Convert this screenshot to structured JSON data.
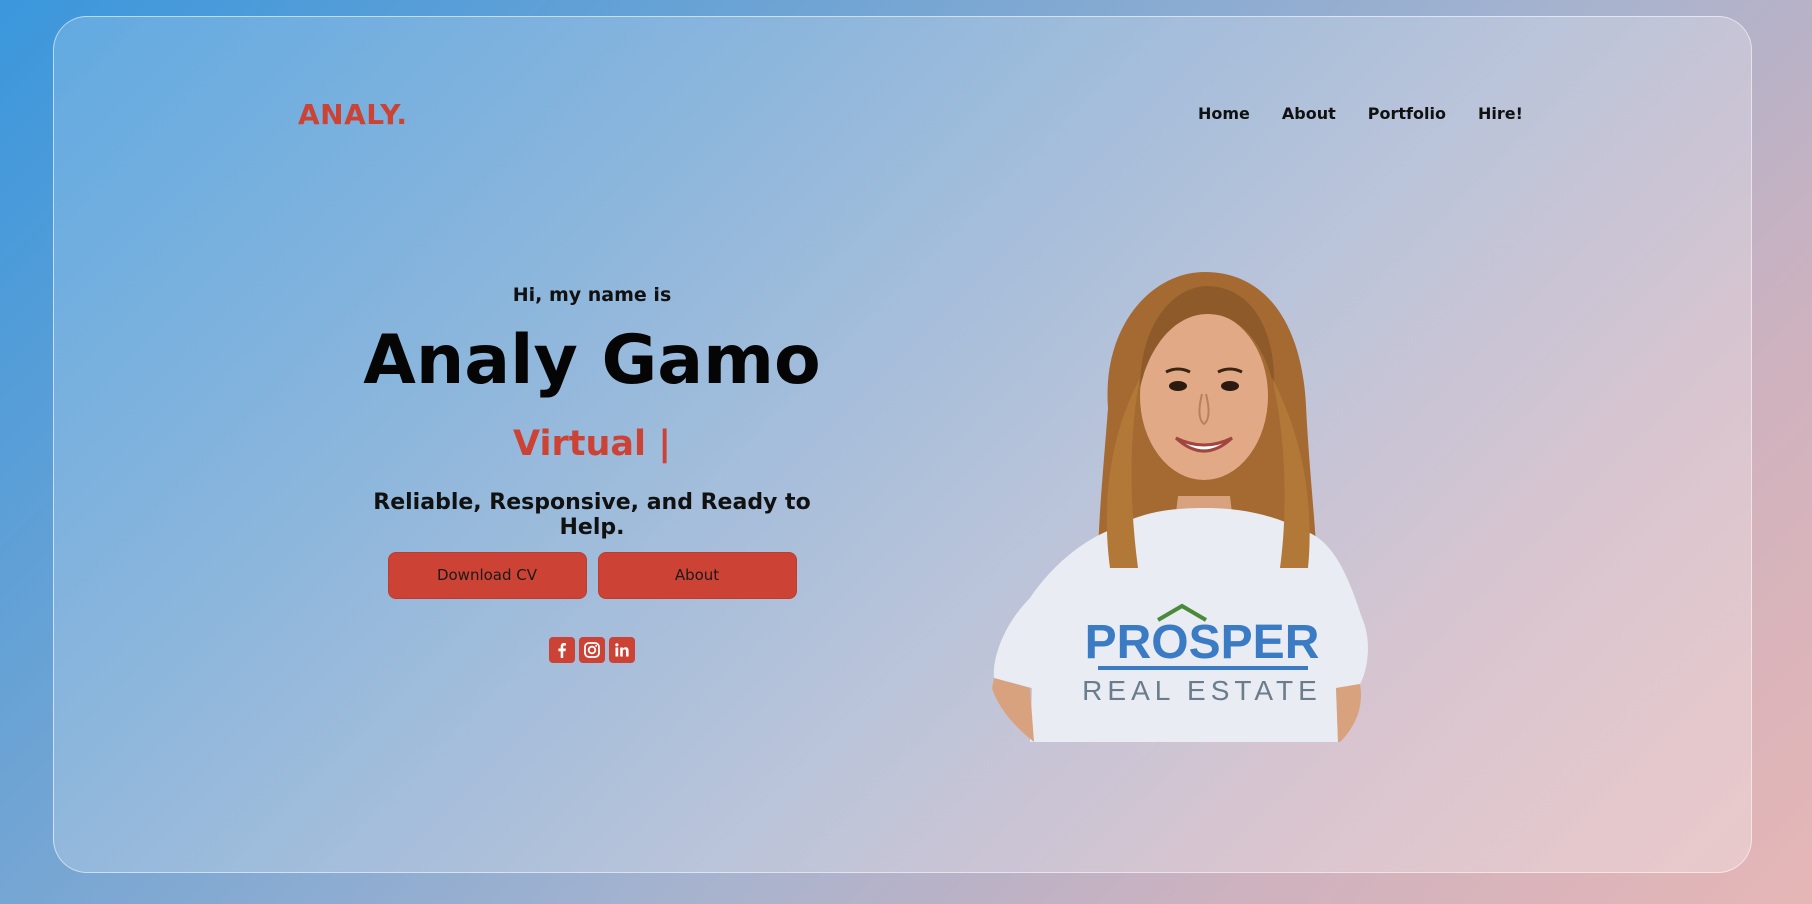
{
  "brand": {
    "logo_text": "ANALY.",
    "accent_color": "#cc4335"
  },
  "nav": {
    "items": [
      {
        "label": "Home"
      },
      {
        "label": "About"
      },
      {
        "label": "Portfolio"
      },
      {
        "label": "Hire!"
      }
    ]
  },
  "hero": {
    "greeting": "Hi, my name is",
    "name": "Analy Gamo",
    "role_typed": "Virtual |",
    "tagline": "Reliable, Responsive, and Ready to Help.",
    "buttons": {
      "download_cv": "Download CV",
      "about": "About"
    },
    "socials": [
      {
        "icon": "facebook-icon"
      },
      {
        "icon": "instagram-icon"
      },
      {
        "icon": "linkedin-icon"
      }
    ]
  },
  "photo": {
    "shirt_line1": "PROSPER",
    "shirt_line2": "REAL ESTATE"
  }
}
